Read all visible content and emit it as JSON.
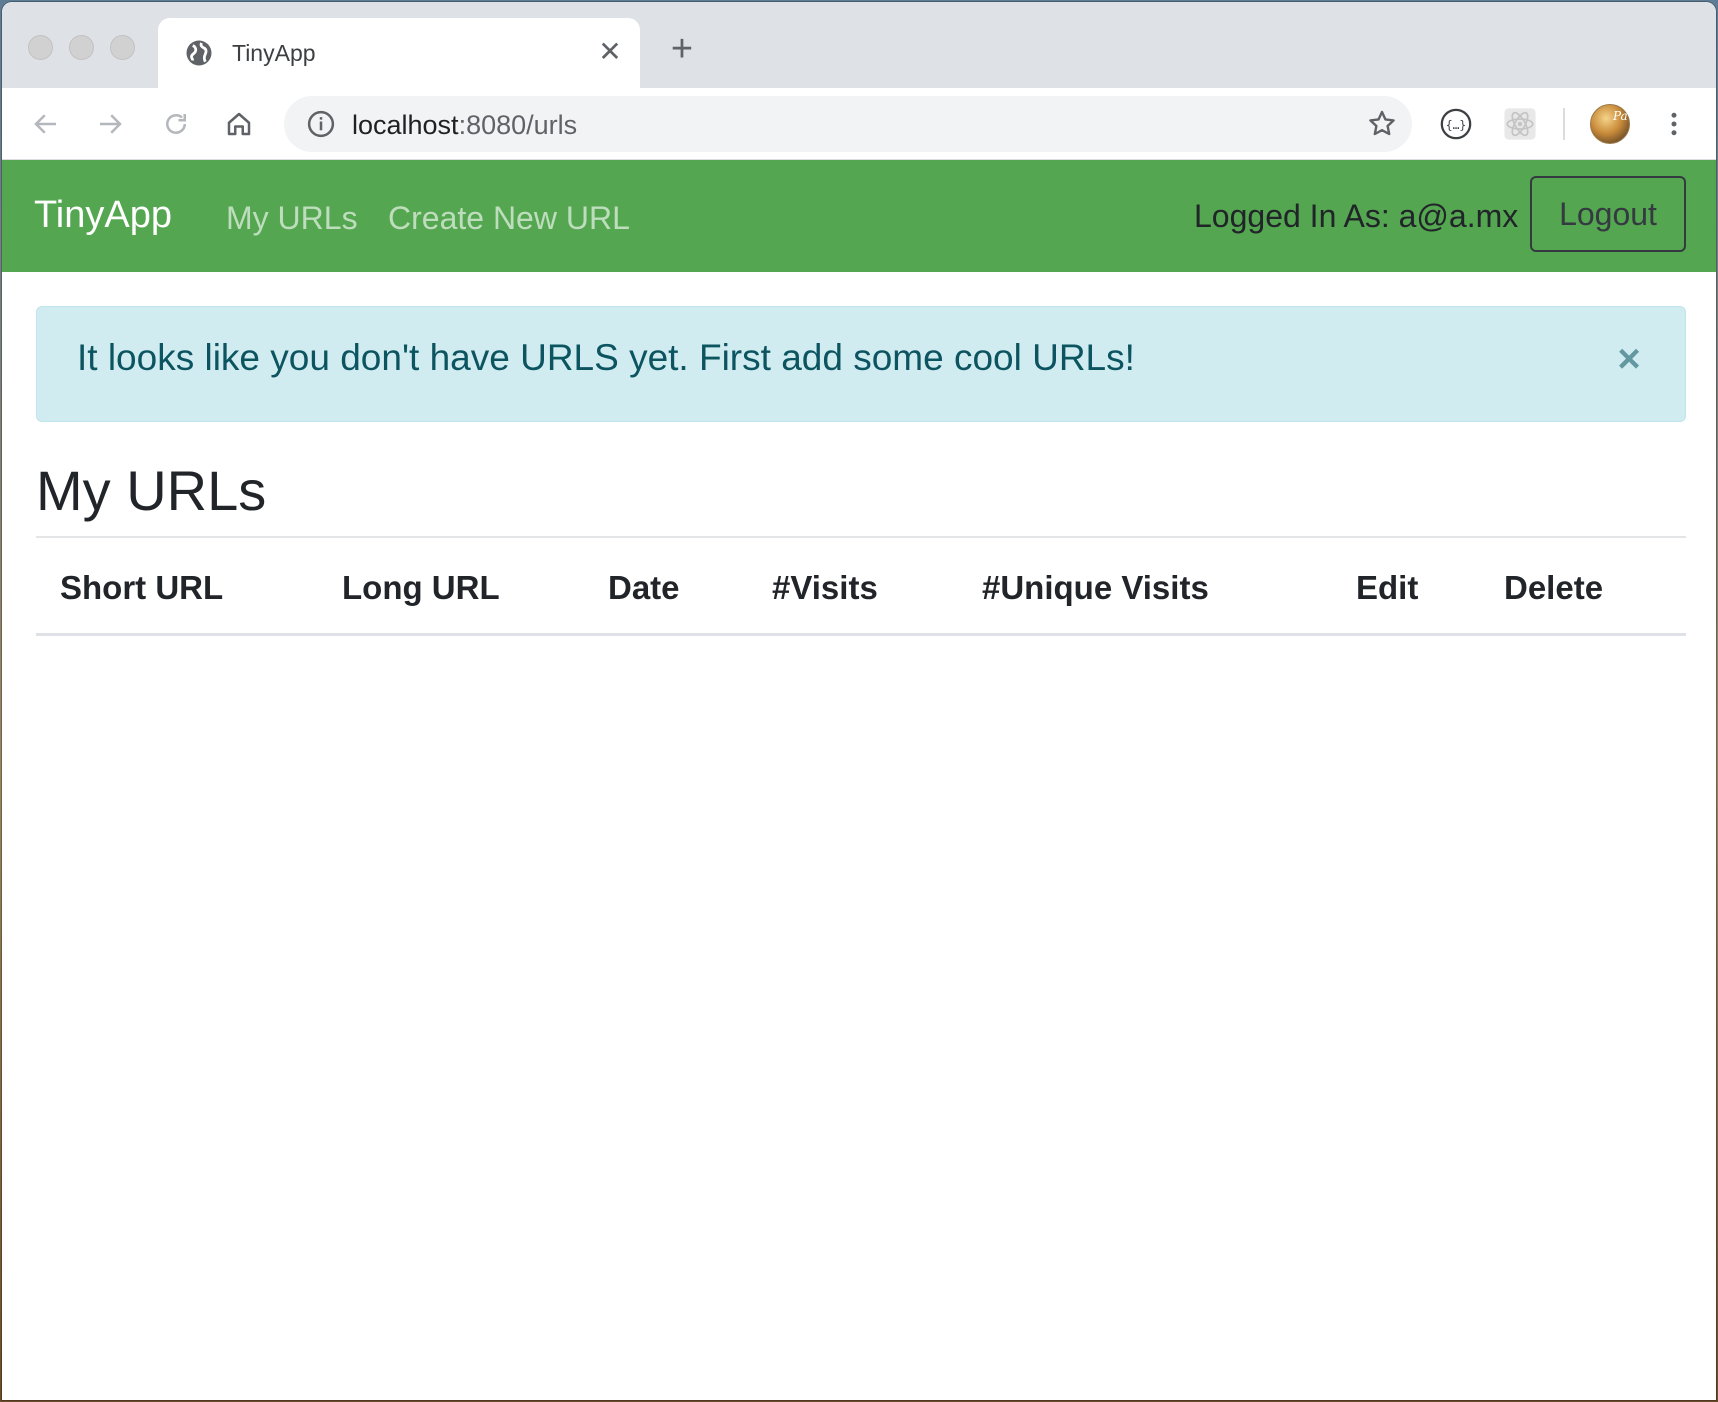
{
  "browser": {
    "tab_title": "TinyApp",
    "url_host": "localhost",
    "url_path": ":8080/urls",
    "new_tab_symbol": "+",
    "close_symbol": "✕",
    "avatar_text": "Pa"
  },
  "navbar": {
    "brand": "TinyApp",
    "links": [
      "My URLs",
      "Create New URL"
    ],
    "logged_in_text": "Logged In As: a@a.mx",
    "logout_label": "Logout",
    "color": "#54a650"
  },
  "alert": {
    "message": "It looks like you don't have URLS yet. First add some cool URLs!",
    "close_symbol": "×",
    "color": "#d1ecf1"
  },
  "main": {
    "title": "My URLs",
    "table_headers": [
      "Short URL",
      "Long URL",
      "Date",
      "#Visits",
      "#Unique Visits",
      "Edit",
      "Delete"
    ],
    "rows": []
  },
  "icons": [
    "globe-icon",
    "close-icon",
    "back-icon",
    "forward-icon",
    "reload-icon",
    "home-icon",
    "info-icon",
    "star-icon",
    "json-viewer-icon",
    "react-devtools-icon",
    "more-menu-icon"
  ]
}
